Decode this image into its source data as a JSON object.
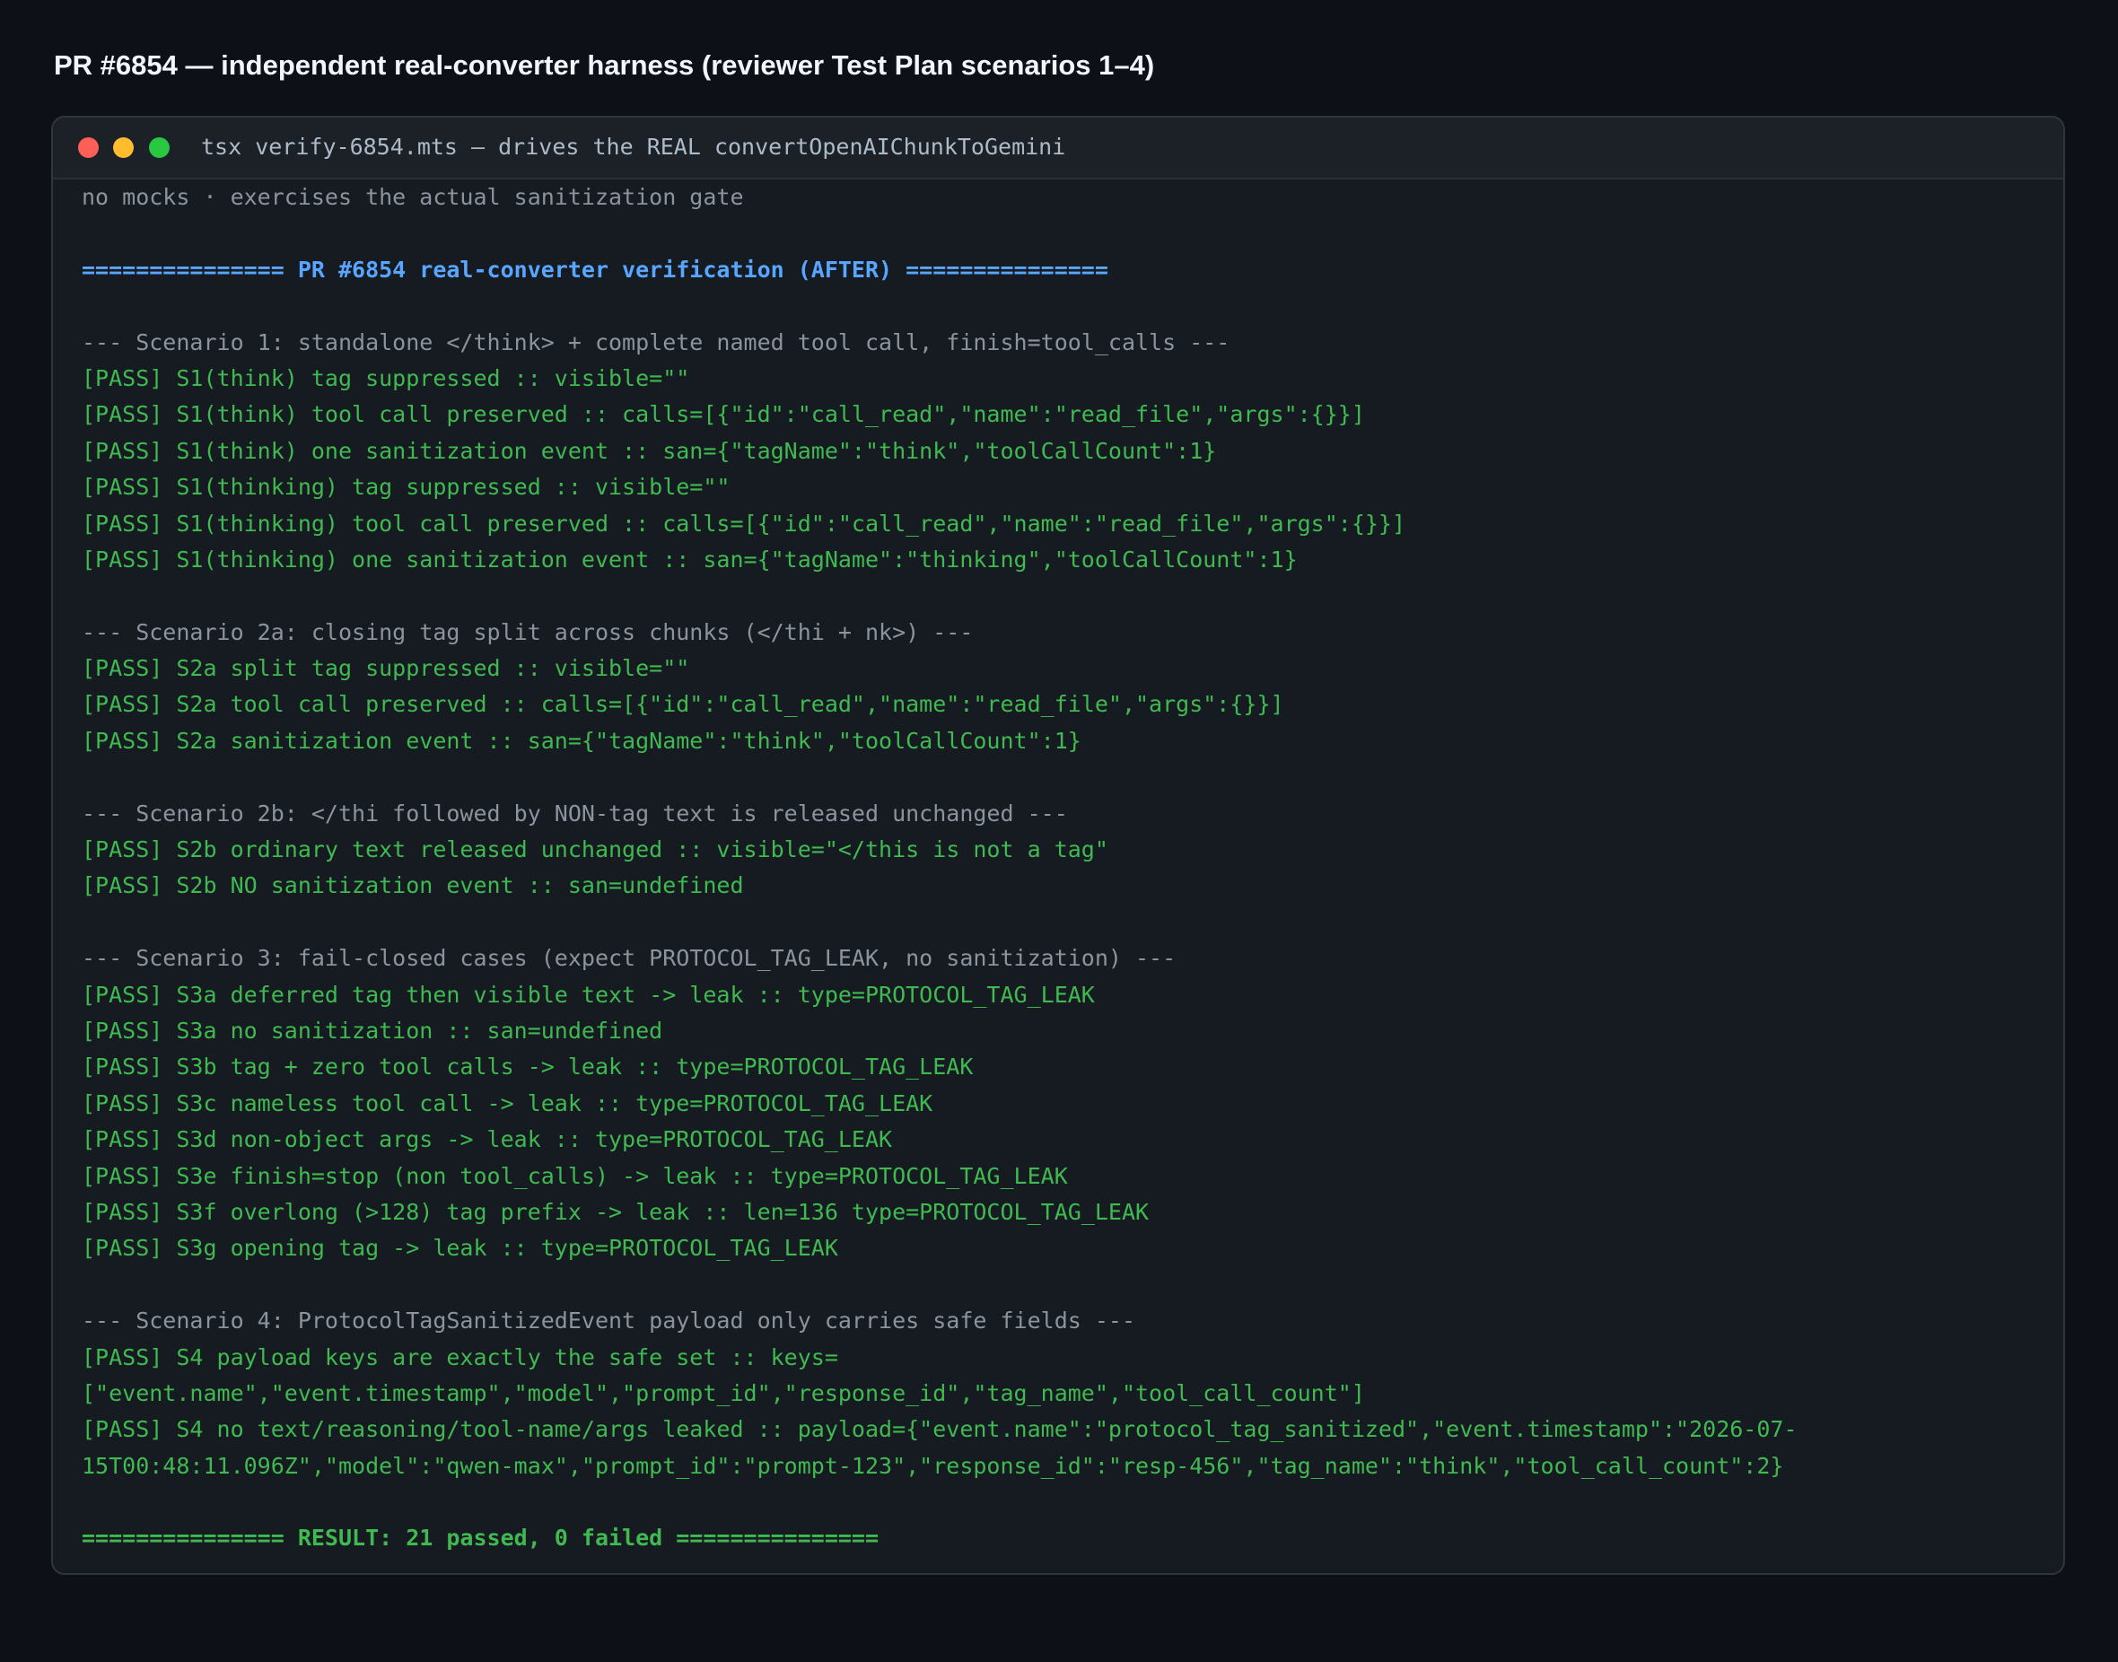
{
  "page": {
    "title": "PR #6854 — independent real-converter harness (reviewer Test Plan scenarios 1–4)"
  },
  "window": {
    "title": "tsx verify-6854.mts — drives the REAL convertOpenAIChunkToGemini",
    "controls": {
      "close_color": "#ff5f57",
      "minimize_color": "#febc2e",
      "maximize_color": "#28c840"
    }
  },
  "colors": {
    "background": "#0d1117",
    "terminal_bg": "#161b22",
    "pass": "#3fb950",
    "banner": "#58a6ff",
    "muted": "#8b949e"
  },
  "console": {
    "lines": [
      {
        "kind": "subtitle",
        "text": "no mocks · exercises the actual sanitization gate"
      },
      {
        "kind": "blank",
        "text": ""
      },
      {
        "kind": "banner",
        "text": "=============== PR #6854 real-converter verification (AFTER) ==============="
      },
      {
        "kind": "blank",
        "text": ""
      },
      {
        "kind": "scenario",
        "text": "--- Scenario 1: standalone </think> + complete named tool call, finish=tool_calls ---"
      },
      {
        "kind": "pass",
        "text": "[PASS] S1(think) tag suppressed :: visible=\"\""
      },
      {
        "kind": "pass",
        "text": "[PASS] S1(think) tool call preserved :: calls=[{\"id\":\"call_read\",\"name\":\"read_file\",\"args\":{}}]"
      },
      {
        "kind": "pass",
        "text": "[PASS] S1(think) one sanitization event :: san={\"tagName\":\"think\",\"toolCallCount\":1}"
      },
      {
        "kind": "pass",
        "text": "[PASS] S1(thinking) tag suppressed :: visible=\"\""
      },
      {
        "kind": "pass",
        "text": "[PASS] S1(thinking) tool call preserved :: calls=[{\"id\":\"call_read\",\"name\":\"read_file\",\"args\":{}}]"
      },
      {
        "kind": "pass",
        "text": "[PASS] S1(thinking) one sanitization event :: san={\"tagName\":\"thinking\",\"toolCallCount\":1}"
      },
      {
        "kind": "blank",
        "text": ""
      },
      {
        "kind": "scenario",
        "text": "--- Scenario 2a: closing tag split across chunks (</thi + nk>) ---"
      },
      {
        "kind": "pass",
        "text": "[PASS] S2a split tag suppressed :: visible=\"\""
      },
      {
        "kind": "pass",
        "text": "[PASS] S2a tool call preserved :: calls=[{\"id\":\"call_read\",\"name\":\"read_file\",\"args\":{}}]"
      },
      {
        "kind": "pass",
        "text": "[PASS] S2a sanitization event :: san={\"tagName\":\"think\",\"toolCallCount\":1}"
      },
      {
        "kind": "blank",
        "text": ""
      },
      {
        "kind": "scenario",
        "text": "--- Scenario 2b: </thi followed by NON-tag text is released unchanged ---"
      },
      {
        "kind": "pass",
        "text": "[PASS] S2b ordinary text released unchanged :: visible=\"</this is not a tag\""
      },
      {
        "kind": "pass",
        "text": "[PASS] S2b NO sanitization event :: san=undefined"
      },
      {
        "kind": "blank",
        "text": ""
      },
      {
        "kind": "scenario",
        "text": "--- Scenario 3: fail-closed cases (expect PROTOCOL_TAG_LEAK, no sanitization) ---"
      },
      {
        "kind": "pass",
        "text": "[PASS] S3a deferred tag then visible text -> leak :: type=PROTOCOL_TAG_LEAK"
      },
      {
        "kind": "pass",
        "text": "[PASS] S3a no sanitization :: san=undefined"
      },
      {
        "kind": "pass",
        "text": "[PASS] S3b tag + zero tool calls -> leak :: type=PROTOCOL_TAG_LEAK"
      },
      {
        "kind": "pass",
        "text": "[PASS] S3c nameless tool call -> leak :: type=PROTOCOL_TAG_LEAK"
      },
      {
        "kind": "pass",
        "text": "[PASS] S3d non-object args -> leak :: type=PROTOCOL_TAG_LEAK"
      },
      {
        "kind": "pass",
        "text": "[PASS] S3e finish=stop (non tool_calls) -> leak :: type=PROTOCOL_TAG_LEAK"
      },
      {
        "kind": "pass",
        "text": "[PASS] S3f overlong (>128) tag prefix -> leak :: len=136 type=PROTOCOL_TAG_LEAK"
      },
      {
        "kind": "pass",
        "text": "[PASS] S3g opening tag -> leak :: type=PROTOCOL_TAG_LEAK"
      },
      {
        "kind": "blank",
        "text": ""
      },
      {
        "kind": "scenario",
        "text": "--- Scenario 4: ProtocolTagSanitizedEvent payload only carries safe fields ---"
      },
      {
        "kind": "pass",
        "text": "[PASS] S4 payload keys are exactly the safe set :: keys="
      },
      {
        "kind": "pass-cont",
        "text": "[\"event.name\",\"event.timestamp\",\"model\",\"prompt_id\",\"response_id\",\"tag_name\",\"tool_call_count\"]"
      },
      {
        "kind": "pass",
        "text": "[PASS] S4 no text/reasoning/tool-name/args leaked :: payload={\"event.name\":\"protocol_tag_sanitized\",\"event.timestamp\":\"2026-07-"
      },
      {
        "kind": "pass-cont",
        "text": "15T00:48:11.096Z\",\"model\":\"qwen-max\",\"prompt_id\":\"prompt-123\",\"response_id\":\"resp-456\",\"tag_name\":\"think\",\"tool_call_count\":2}"
      },
      {
        "kind": "blank",
        "text": ""
      },
      {
        "kind": "result",
        "text": "=============== RESULT: 21 passed, 0 failed ==============="
      }
    ]
  }
}
